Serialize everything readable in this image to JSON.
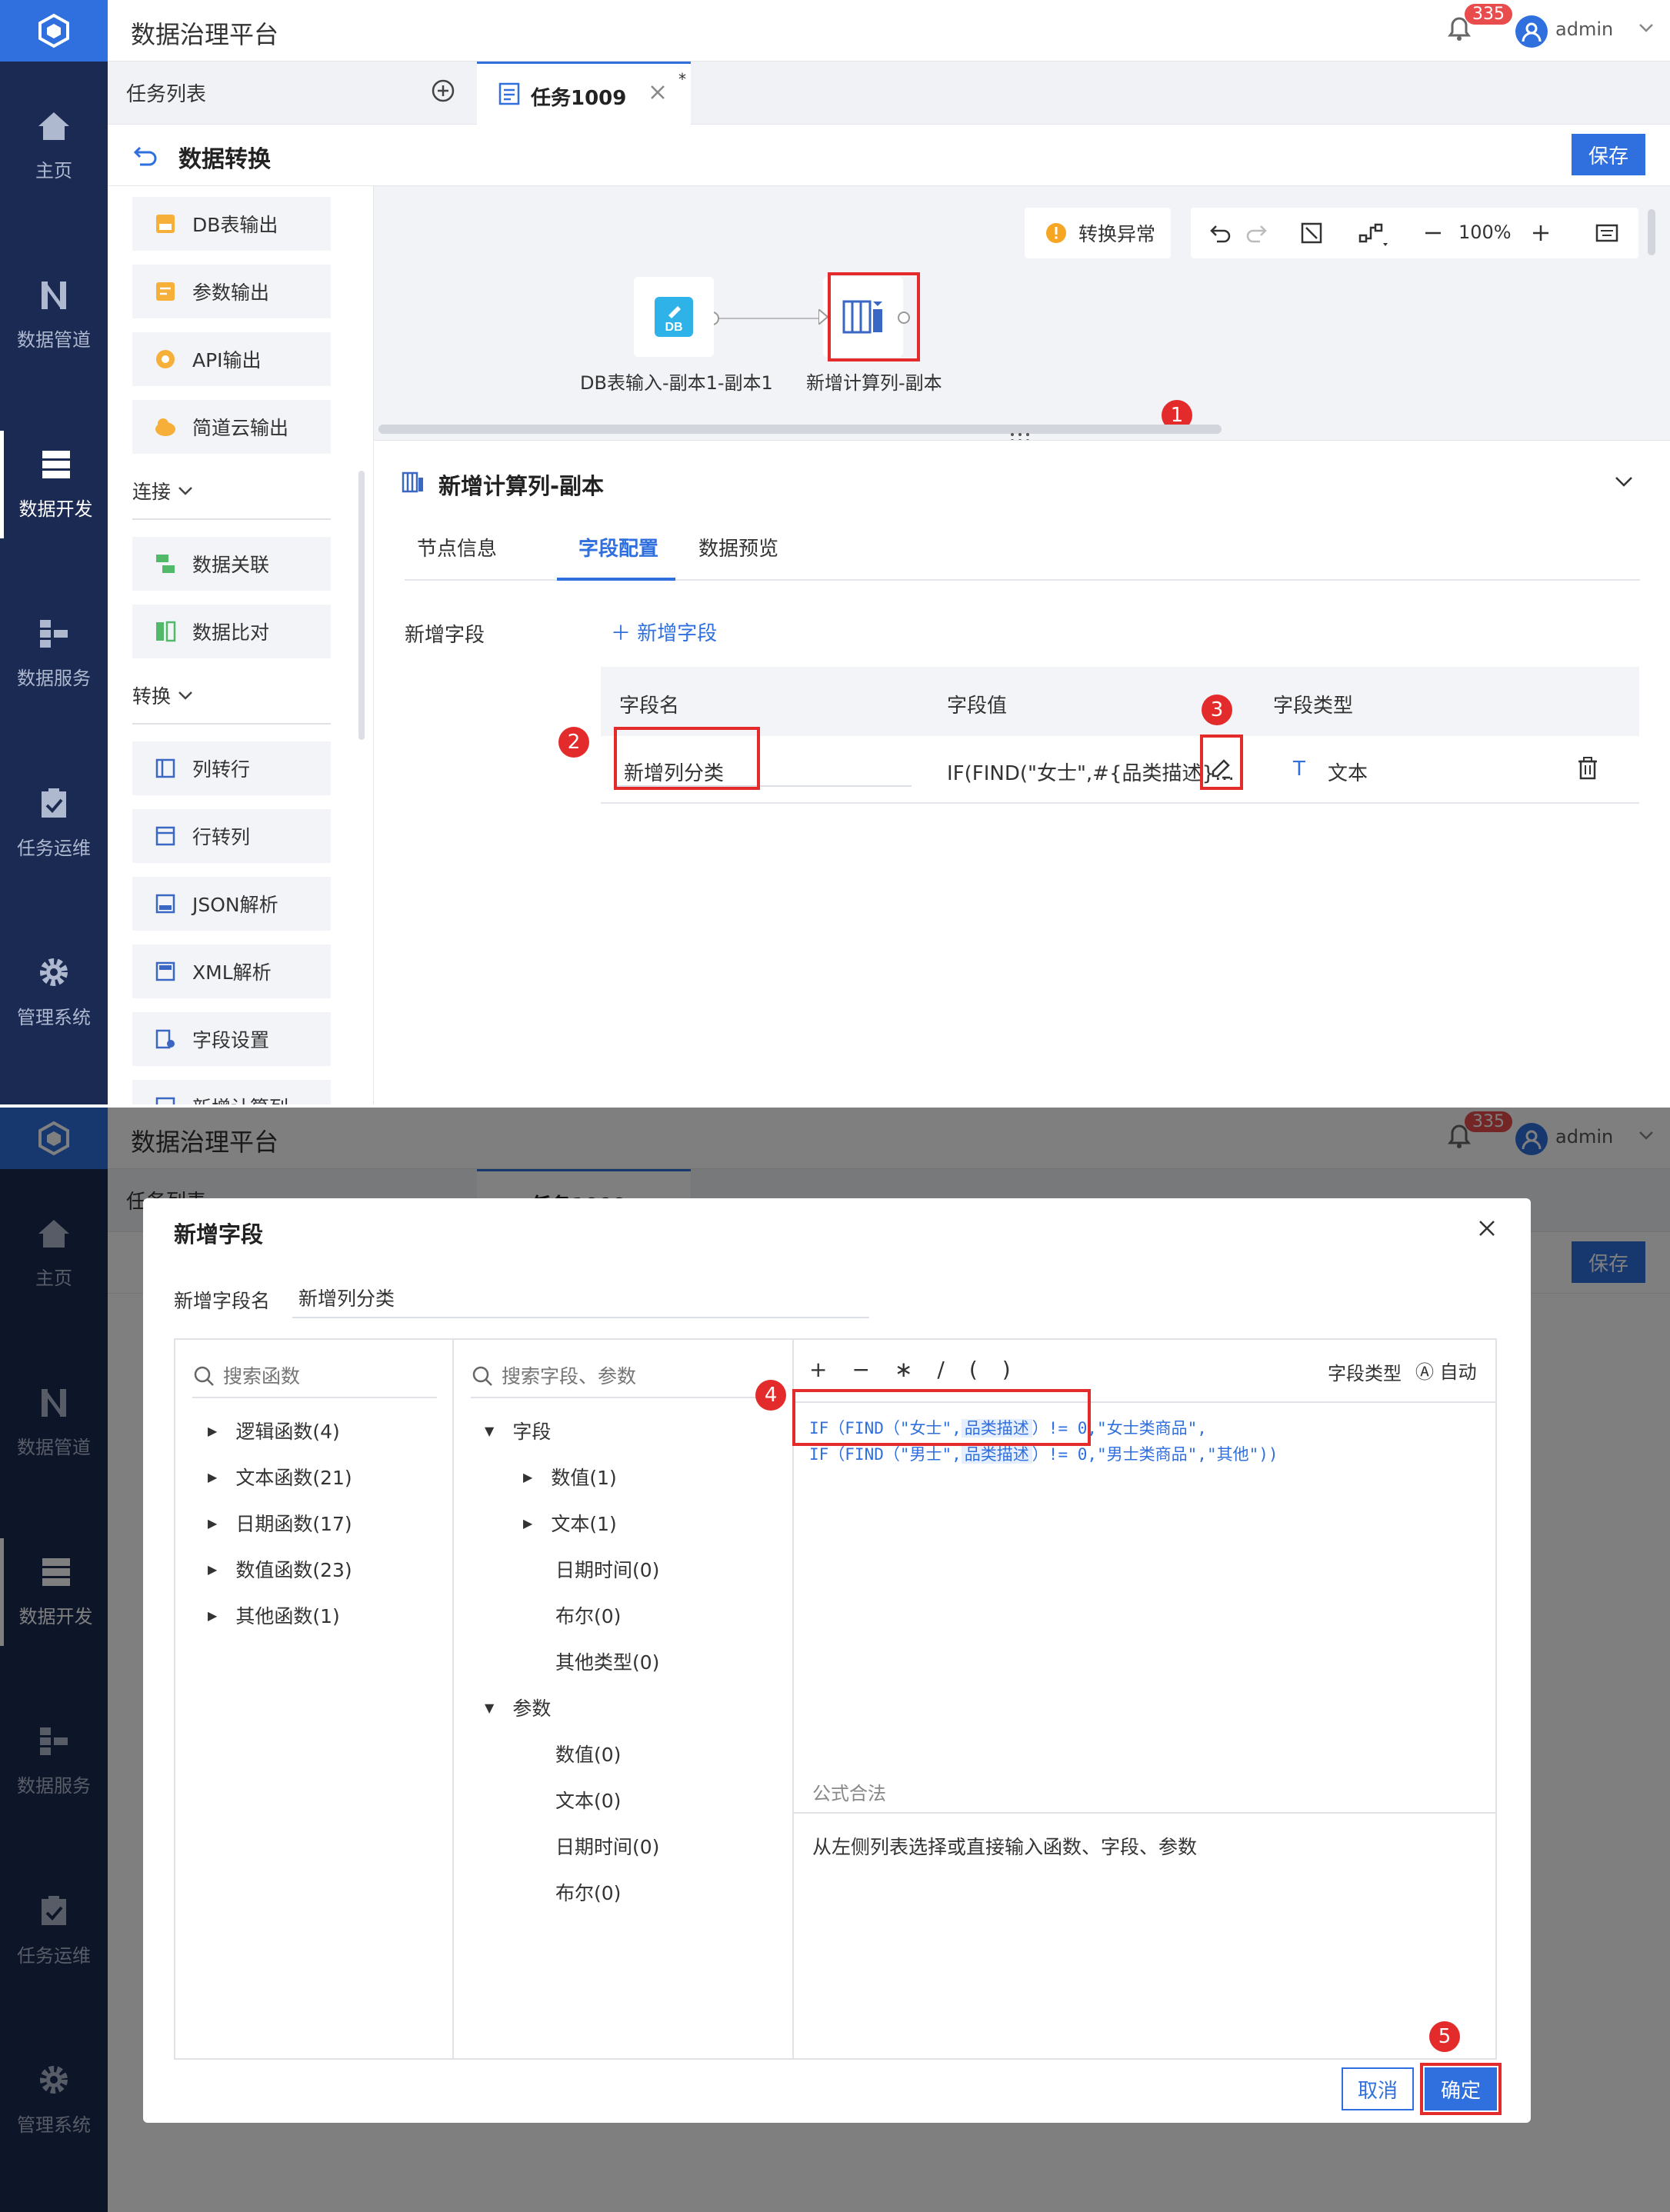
{
  "app": {
    "title": "数据治理平台",
    "notifications": "335",
    "user": "admin"
  },
  "nav": [
    "主页",
    "数据管道",
    "数据开发",
    "数据服务",
    "任务运维",
    "管理系统"
  ],
  "tabs": {
    "list_label": "任务列表",
    "active_label": "任务1009",
    "modified_mark": "*"
  },
  "header": {
    "title": "数据转换",
    "save_label": "保存"
  },
  "left_panel": {
    "outputs": [
      "DB表输出",
      "参数输出",
      "API输出",
      "简道云输出"
    ],
    "group_connect": "连接",
    "connect_items": [
      "数据关联",
      "数据比对"
    ],
    "group_transform": "转换",
    "transform_items": [
      "列转行",
      "行转列",
      "JSON解析",
      "XML解析",
      "字段设置",
      "新增计算列"
    ]
  },
  "canvas": {
    "status": "转换异常",
    "zoom": "100%",
    "nodes": [
      {
        "label": "DB表输入-副本1-副本1",
        "icon_text": "DB"
      },
      {
        "label": "新增计算列-副本"
      }
    ]
  },
  "detail": {
    "title": "新增计算列-副本",
    "tabs": [
      "节点信息",
      "字段配置",
      "数据预览"
    ],
    "new_field_label": "新增字段",
    "add_field": "新增字段",
    "columns": [
      "字段名",
      "字段值",
      "字段类型"
    ],
    "row": {
      "name": "新增列分类",
      "value": "IF(FIND(\"女士\",#{品类描述}…",
      "type": "文本"
    }
  },
  "modal": {
    "title": "新增字段",
    "name_label": "新增字段名",
    "name_value": "新增列分类",
    "func_search_placeholder": "搜索函数",
    "functions": [
      "逻辑函数(4)",
      "文本函数(21)",
      "日期函数(17)",
      "数值函数(23)",
      "其他函数(1)"
    ],
    "field_search_placeholder": "搜索字段、参数",
    "fields_group": "字段",
    "fields": [
      "数值(1)",
      "文本(1)",
      "日期时间(0)",
      "布尔(0)",
      "其他类型(0)"
    ],
    "params_group": "参数",
    "params": [
      "数值(0)",
      "文本(0)",
      "日期时间(0)",
      "布尔(0)"
    ],
    "operators": [
      "+",
      "−",
      "∗",
      "/",
      "(",
      ")"
    ],
    "field_type_label": "字段类型",
    "field_type_value": "自动",
    "formula_line1_a": "IF（FIND（\"女士\",",
    "formula_field": "品类描述",
    "formula_line1_b": "）!= 0,\"女士类商品\",",
    "formula_line2_a": "IF（FIND（\"男士\",",
    "formula_line2_b": "）!= 0,\"男士类商品\",\"其他\"))",
    "valid_label": "公式合法",
    "hint": "从左侧列表选择或直接输入函数、字段、参数",
    "cancel": "取消",
    "ok": "确定"
  },
  "steps": [
    "1",
    "2",
    "3",
    "4",
    "5"
  ]
}
